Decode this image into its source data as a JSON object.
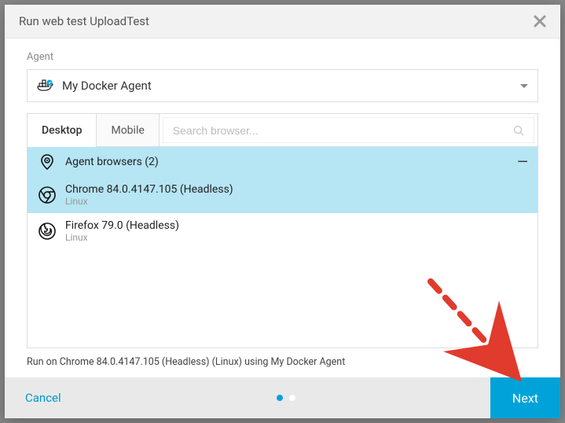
{
  "dialog": {
    "title": "Run web test UploadTest"
  },
  "agent": {
    "label": "Agent",
    "selected": "My Docker Agent"
  },
  "tabs": {
    "desktop": "Desktop",
    "mobile": "Mobile"
  },
  "search": {
    "placeholder": "Search browser..."
  },
  "group": {
    "title": "Agent browsers (2)"
  },
  "browsers": [
    {
      "name": "Chrome 84.0.4147.105 (Headless)",
      "os": "Linux",
      "selected": true,
      "type": "chrome"
    },
    {
      "name": "Firefox 79.0 (Headless)",
      "os": "Linux",
      "selected": false,
      "type": "firefox"
    }
  ],
  "summary": "Run on Chrome 84.0.4147.105 (Headless) (Linux) using My Docker Agent",
  "footer": {
    "cancel": "Cancel",
    "next": "Next"
  },
  "colors": {
    "accent": "#00a3d9",
    "highlight": "#b6e5f4",
    "annotation": "#e03b2d"
  }
}
